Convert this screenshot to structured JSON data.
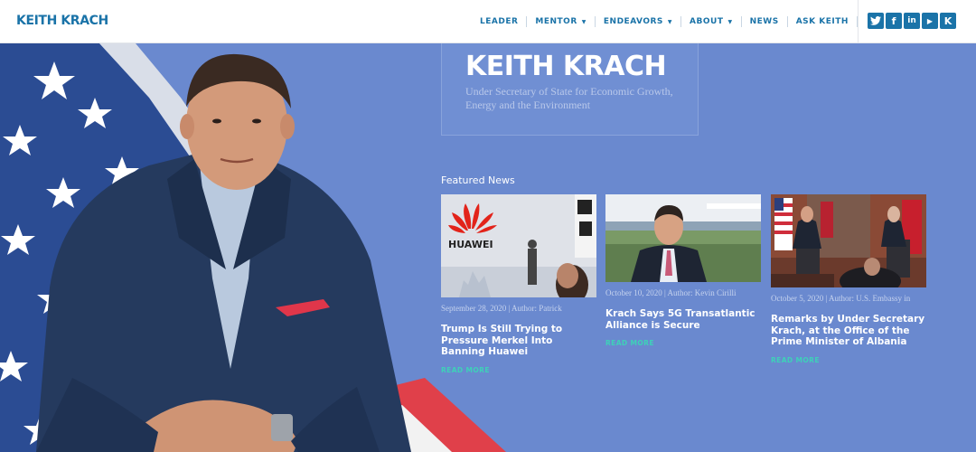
{
  "header": {
    "logo": "KEITH KRACH",
    "nav": [
      {
        "label": "LEADER",
        "dropdown": false
      },
      {
        "label": "MENTOR",
        "dropdown": true
      },
      {
        "label": "ENDEAVORS",
        "dropdown": true
      },
      {
        "label": "ABOUT",
        "dropdown": true
      },
      {
        "label": "NEWS",
        "dropdown": false
      },
      {
        "label": "ASK KEITH",
        "dropdown": false
      }
    ],
    "search_icon": "search-icon",
    "social": [
      {
        "name": "twitter-icon",
        "glyph": "t"
      },
      {
        "name": "facebook-icon",
        "glyph": "f"
      },
      {
        "name": "linkedin-icon",
        "glyph": "in"
      },
      {
        "name": "youtube-icon",
        "glyph": "▶"
      },
      {
        "name": "medium-icon",
        "glyph": "K"
      }
    ]
  },
  "hero": {
    "title": "KEITH KRACH",
    "subtitle": "Under Secretary of State for Economic Growth, Energy and the Environment"
  },
  "featured": {
    "heading": "Featured News",
    "read_more": "READ MORE",
    "articles": [
      {
        "meta": "September 28, 2020 | Author: Patrick",
        "title": "Trump Is Still Trying to Pressure Merkel Into Banning Huawei",
        "image_text": "HUAWEI"
      },
      {
        "meta": "October 10, 2020 | Author: Kevin Cirilli",
        "title": "Krach Says 5G Transatlantic Alliance is Secure",
        "image_text": ""
      },
      {
        "meta": "October 5, 2020 | Author: U.S. Embassy in",
        "title": "Remarks by Under Secretary Krach, at the Office of the Prime Minister of Albania",
        "image_text": ""
      }
    ]
  },
  "colors": {
    "brand_blue": "#1a73a8",
    "hero_background": "#6a89cf",
    "read_more": "#3ed1b8"
  }
}
